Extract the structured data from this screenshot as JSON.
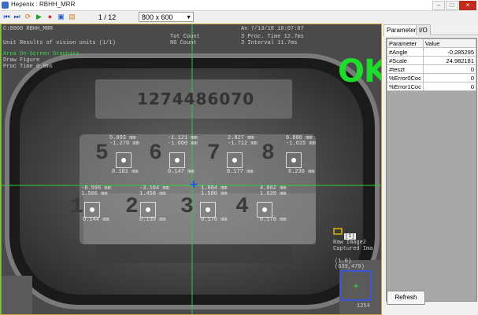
{
  "window": {
    "title": "Hepenix : RBHH_MRR",
    "minimize": "–",
    "maximize": "□",
    "close": "×"
  },
  "toolbar": {
    "page": "1  /  12",
    "resolution": "800 x 600"
  },
  "overlay": {
    "camera": "C:0000 RBHH_MRR",
    "unit_results": "Unit Results of vision units (1/1)",
    "on_screen": "Area On-Screen Graphics",
    "draw_figure": "Draw Figure",
    "proc_time": "Proc Time      0.0ms",
    "tot_count": "Tot Count",
    "ng_count": "NG Count",
    "stats_right": [
      "An 7/13/18   10:07:07",
      "3  Proc. Time    12.7ms",
      "3  Interval      11.7ms"
    ],
    "ok_label": "OK",
    "part_number": "1274486070",
    "raw_image": [
      "Raw Image2",
      "Captured Ima"
    ],
    "roi_label": "[1]",
    "coord": [
      "(1.0)",
      "(639,479)"
    ],
    "frame_no": "1254"
  },
  "measurements": [
    {
      "top": "5.093 mm",
      "mid": "-1.270 mm",
      "bottom": "0.101 mm"
    },
    {
      "top": "-1.121 mm",
      "mid": "-1.660 mm",
      "bottom": "0.147 mm"
    },
    {
      "top": "2.827 mm",
      "mid": "-1.712 mm",
      "bottom": "0.177 mm"
    },
    {
      "top": "6.886 mm",
      "mid": "-1.615 mm",
      "bottom": "0.236 mm"
    },
    {
      "top": "-8.595 mm",
      "mid": "1.506 mm",
      "bottom": "0.144 mm"
    },
    {
      "top": "-3.104 mm",
      "mid": "1.458 mm",
      "bottom": "0.139 mm"
    },
    {
      "top": "1.884 mm",
      "mid": "1.580 mm",
      "bottom": "0.170 mm"
    },
    {
      "top": "4.862 mm",
      "mid": "1.639 mm",
      "bottom": "0.178 mm"
    }
  ],
  "connector_digits": [
    "5",
    "6",
    "7",
    "8",
    "1",
    "2",
    "3",
    "4"
  ],
  "panel": {
    "tabs": [
      "Parameter",
      "I/O"
    ],
    "columns": [
      "Parameter",
      "Value"
    ],
    "rows": [
      {
        "param": "#Angle",
        "value": "-0.285295"
      },
      {
        "param": "#Scale",
        "value": "24.982181"
      },
      {
        "param": "#teszt",
        "value": "0"
      },
      {
        "param": "%Error0Coc",
        "value": "0"
      },
      {
        "param": "%Error1Coc",
        "value": "0"
      }
    ],
    "refresh": "Refresh"
  },
  "icons": [
    "skip-first-icon",
    "skip-last-icon",
    "loop-icon",
    "play-icon",
    "stop-icon",
    "window-icon",
    "chart-icon"
  ],
  "colors": {
    "ok": "#1fdc2c",
    "crosshair": "#2ecc40",
    "marker": "#2244ff",
    "frame": "#c9a441"
  }
}
